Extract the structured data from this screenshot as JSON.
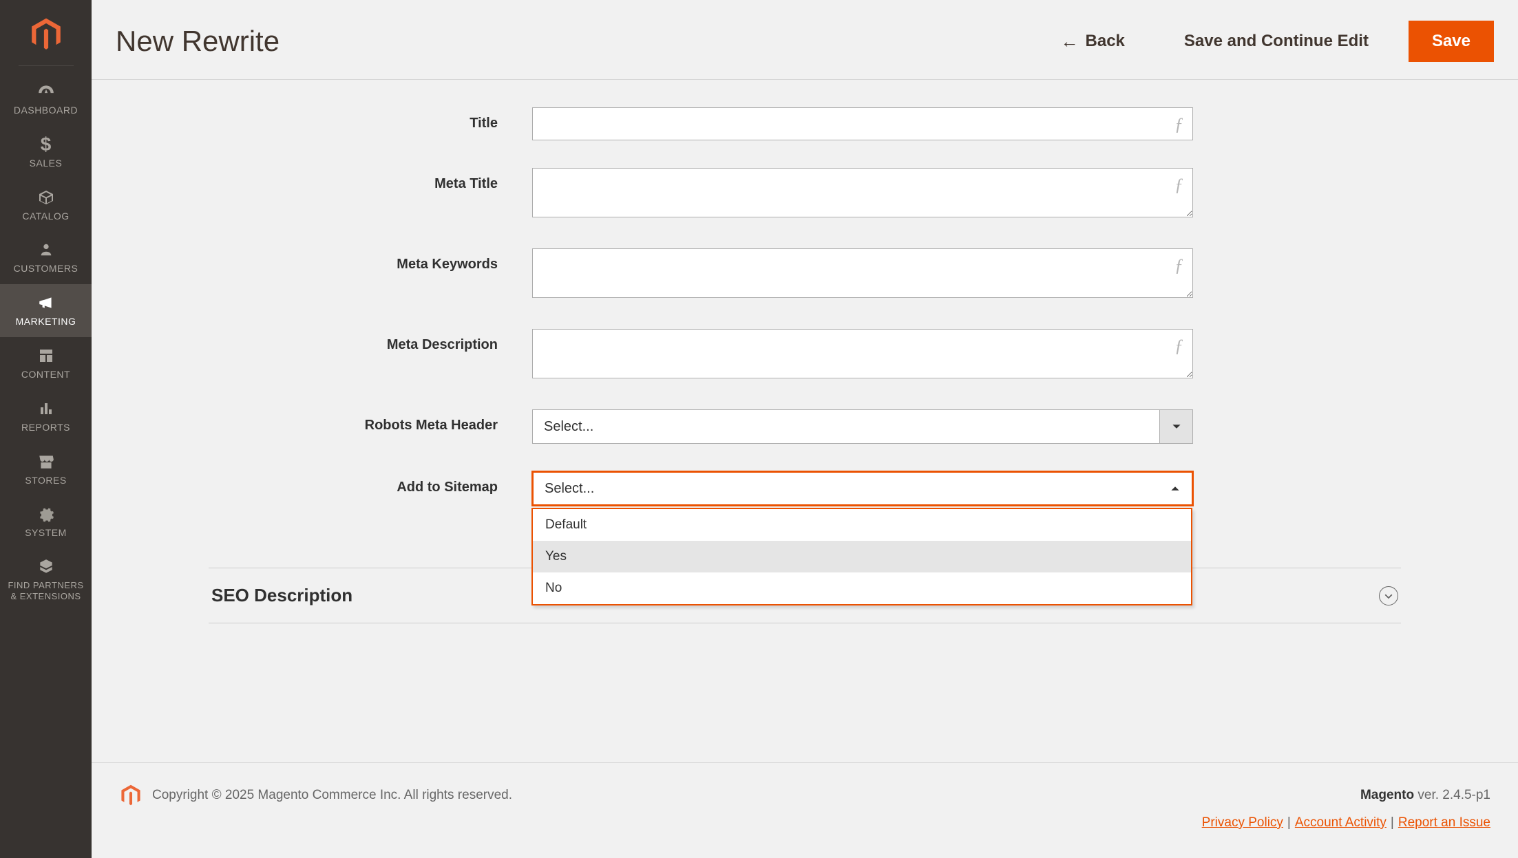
{
  "page": {
    "title": "New Rewrite"
  },
  "actions": {
    "back": "Back",
    "save_continue": "Save and Continue Edit",
    "save": "Save"
  },
  "nav": {
    "dashboard": "DASHBOARD",
    "sales": "SALES",
    "catalog": "CATALOG",
    "customers": "CUSTOMERS",
    "marketing": "MARKETING",
    "content": "CONTENT",
    "reports": "REPORTS",
    "stores": "STORES",
    "system": "SYSTEM",
    "find_partners": "FIND PARTNERS\n& EXTENSIONS"
  },
  "form": {
    "title_label": "Title",
    "meta_title_label": "Meta Title",
    "meta_keywords_label": "Meta Keywords",
    "meta_description_label": "Meta Description",
    "robots_label": "Robots Meta Header",
    "sitemap_label": "Add to Sitemap",
    "select_placeholder": "Select...",
    "sitemap_options": {
      "0": "Default",
      "1": "Yes",
      "2": "No"
    }
  },
  "sections": {
    "seo_description": "SEO Description"
  },
  "footer": {
    "copyright": "Copyright © 2025 Magento Commerce Inc. All rights reserved.",
    "product": "Magento",
    "version": " ver. 2.4.5-p1",
    "privacy": "Privacy Policy",
    "activity": " Account Activity",
    "report": "Report an Issue"
  }
}
